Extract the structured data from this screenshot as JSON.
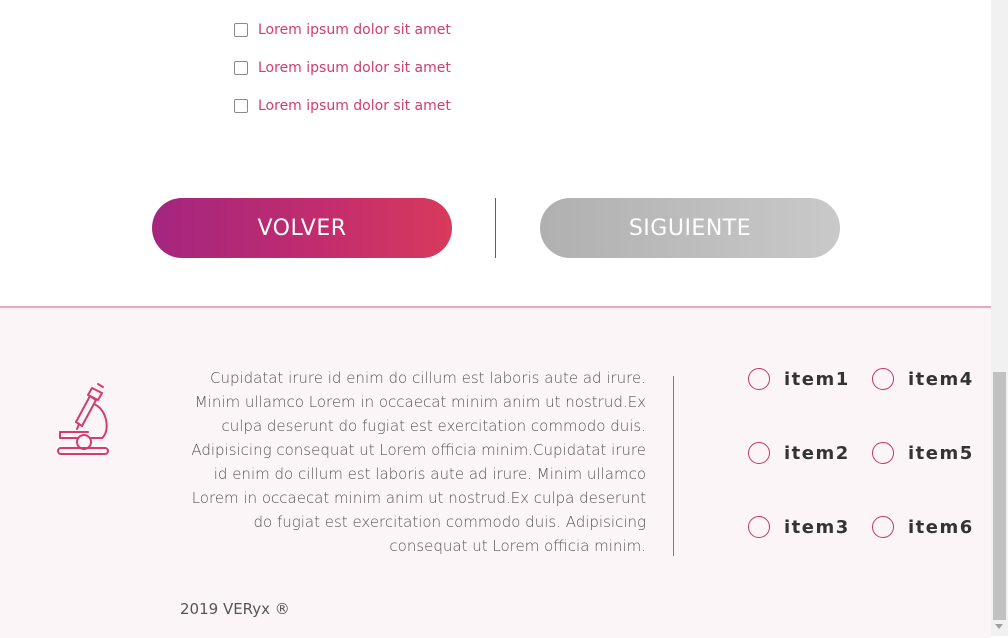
{
  "checkboxes": [
    {
      "label": "Lorem ipsum dolor sit amet",
      "checked": false
    },
    {
      "label": "Lorem ipsum dolor sit amet",
      "checked": false
    },
    {
      "label": "Lorem ipsum dolor sit amet",
      "checked": false
    }
  ],
  "buttons": {
    "back_label": "VOLVER",
    "next_label": "SIGUIENTE"
  },
  "footer": {
    "icon": "microscope-icon",
    "text": "Cupidatat irure id enim do cillum est laboris aute ad irure. Minim ullamco Lorem in occaecat minim anim ut nostrud.Ex culpa deserunt do fugiat est exercitation commodo duis. Adipisicing consequat ut Lorem officia minim.Cupidatat irure id enim do cillum est laboris aute ad irure. Minim ullamco Lorem in occaecat minim anim ut nostrud.Ex culpa deserunt do fugiat est exercitation commodo duis. Adipisicing consequat ut Lorem officia minim.",
    "items": [
      "item1",
      "item4",
      "item2",
      "item5",
      "item3",
      "item6"
    ],
    "copyright": "2019 VERyx ®"
  },
  "colors": {
    "accent": "#c4366a",
    "gradient_start": "#a3267f",
    "gradient_end": "#d83a5c",
    "disabled": "#bdbdbd",
    "footer_bg": "#fcf5f7"
  }
}
